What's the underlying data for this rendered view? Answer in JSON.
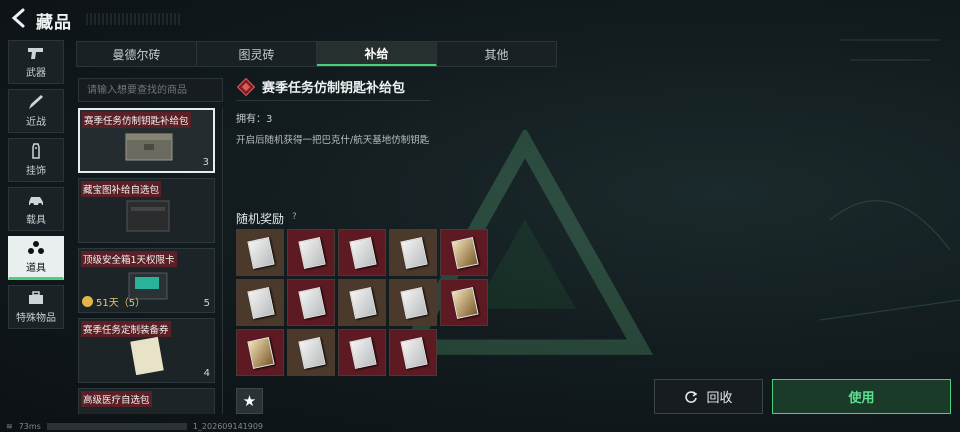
{
  "header": {
    "title": "藏品"
  },
  "nav": {
    "items": [
      {
        "label": "武器",
        "icon": "pistol-icon"
      },
      {
        "label": "近战",
        "icon": "knife-icon"
      },
      {
        "label": "挂饰",
        "icon": "tag-icon"
      },
      {
        "label": "载具",
        "icon": "vehicle-icon"
      },
      {
        "label": "道具",
        "icon": "items-icon",
        "active": true
      },
      {
        "label": "特殊物品",
        "icon": "briefcase-icon"
      }
    ]
  },
  "tabs": [
    {
      "label": "曼德尔砖"
    },
    {
      "label": "图灵砖"
    },
    {
      "label": "补给",
      "active": true
    },
    {
      "label": "其他"
    }
  ],
  "search": {
    "placeholder": "请输入想要查找的商品"
  },
  "items": [
    {
      "name": "赛季任务仿制钥匙补给包",
      "count": "3",
      "selected": true
    },
    {
      "name": "藏宝图补给自选包",
      "count": ""
    },
    {
      "name": "顶级安全箱1天权限卡",
      "count": "5",
      "timer": "51天（5）"
    },
    {
      "name": "赛季任务定制装备券",
      "count": "4"
    },
    {
      "name": "高级医疗自选包",
      "count": ""
    }
  ],
  "detail": {
    "title": "赛季任务仿制钥匙补给包",
    "owned": "拥有：3",
    "description": "开启后随机获得一把巴克什/航天基地仿制钥匙",
    "reward_label": "随机奖励",
    "help": "?"
  },
  "rewards": [
    "brown",
    "red",
    "red",
    "brown",
    "red-gold",
    "brown",
    "red",
    "brown",
    "brown",
    "red-gold",
    "red-gold",
    "brown",
    "red",
    "red"
  ],
  "actions": {
    "recycle": "回收",
    "use": "使用",
    "star": "★"
  },
  "status": {
    "ping": "73ms",
    "build": "1_202609141909"
  },
  "colors": {
    "accent": "#46d17a",
    "rarity_red": "#5e1a22",
    "rarity_brown": "#4b3a2c"
  }
}
